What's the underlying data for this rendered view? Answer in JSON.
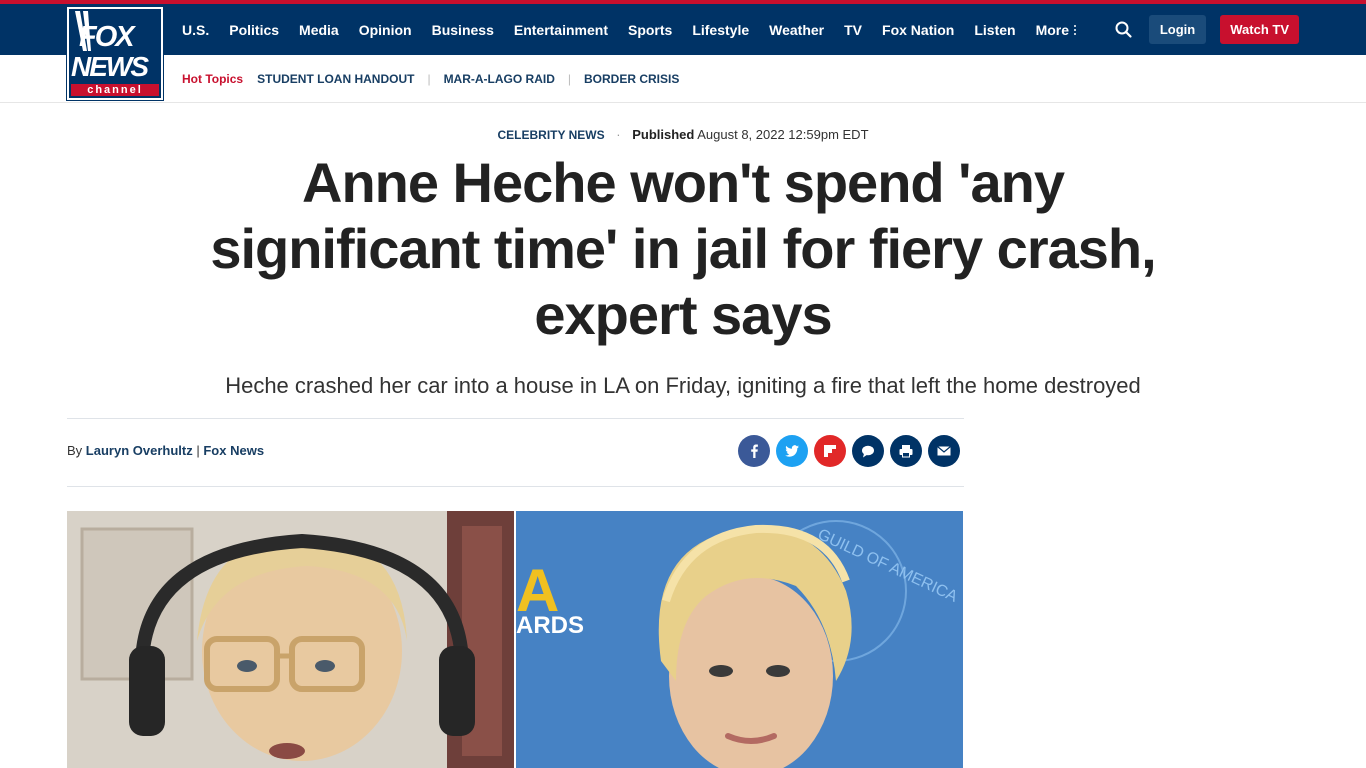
{
  "brand": {
    "logo_line1": "FOX",
    "logo_line2": "NEWS",
    "logo_line3": "channel",
    "colors": {
      "navy": "#003366",
      "red": "#c8102e",
      "link": "#183e63"
    }
  },
  "nav": {
    "items": [
      "U.S.",
      "Politics",
      "Media",
      "Opinion",
      "Business",
      "Entertainment",
      "Sports",
      "Lifestyle",
      "Weather",
      "TV",
      "Fox Nation",
      "Listen"
    ],
    "more_label": "More",
    "login_label": "Login",
    "watch_label": "Watch TV",
    "search_icon": "search-icon"
  },
  "hot_topics": {
    "label": "Hot Topics",
    "items": [
      "STUDENT LOAN HANDOUT",
      "MAR-A-LAGO RAID",
      "BORDER CRISIS"
    ]
  },
  "article": {
    "category": "CELEBRITY NEWS",
    "published_label": "Published",
    "published_date": "August 8, 2022 12:59pm EDT",
    "headline": "Anne Heche won't spend 'any significant time' in jail for fiery crash, expert says",
    "subhead": "Heche crashed her car into a house in LA on Friday, igniting a fire that left the home destroyed",
    "by_label": "By",
    "author": "Lauryn Overhultz",
    "divider": "|",
    "outlet": "Fox News",
    "share_icons": [
      "facebook-icon",
      "twitter-icon",
      "flipboard-icon",
      "comments-icon",
      "print-icon",
      "email-icon"
    ],
    "share_colors": [
      "#3b5998",
      "#1da1f2",
      "#e12828",
      "#003366",
      "#003366",
      "#003366"
    ],
    "image_right_text_1": "A",
    "image_right_text_2": "ARDS",
    "image_right_text_3": "GUILD OF AMERICA"
  }
}
